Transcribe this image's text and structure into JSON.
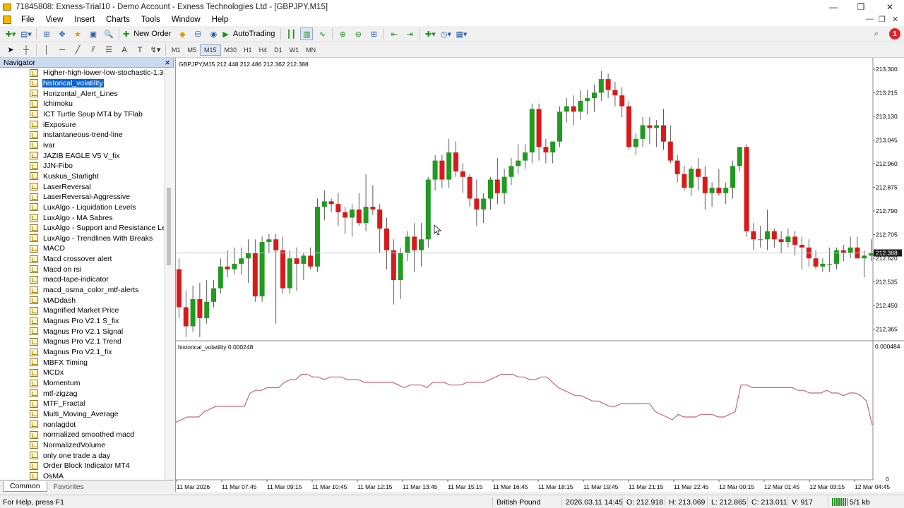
{
  "window": {
    "title": "71845808: Exness-Trial10 - Demo Account - Exness Technologies Ltd - [GBPJPY,M15]",
    "minimize": "—",
    "restore": "❐",
    "close": "✕"
  },
  "menu": [
    "File",
    "View",
    "Insert",
    "Charts",
    "Tools",
    "Window",
    "Help"
  ],
  "toolbar": {
    "new_order": "New Order",
    "autotrading": "AutoTrading",
    "alerts_badge": "1"
  },
  "timeframes": [
    "M1",
    "M5",
    "M15",
    "M30",
    "H1",
    "H4",
    "D1",
    "W1",
    "MN"
  ],
  "active_timeframe": "M15",
  "navigator": {
    "title": "Navigator",
    "close": "×",
    "items": [
      "Higher-high-lower-low-stochastic-1.3",
      "historical_volatility",
      "Horizontal_Alert_Lines",
      "Ichimoku",
      "ICT Turtle Soup MT4 by TFlab",
      "iExposure",
      "instantaneous-trend-line",
      "ivar",
      "JAZIB EAGLE V5 V_fix",
      "JJN-Fibo",
      "Kuskus_Starlight",
      "LaserReversal",
      "LaserReversal-Aggressive",
      "LuxAlgo - Liquidation Levels",
      "LuxAlgo - MA Sabres",
      "LuxAlgo - Support and Resistance Levels",
      "LuxAlgo - Trendlines With Breaks",
      "MACD",
      "Macd crossover alert",
      "Macd on rsi",
      "macd-tape-indicator",
      "macd_osma_color_mtf-alerts",
      "MADdash",
      "Magnified Market Price",
      "Magnus Pro V2.1 S_fix",
      "Magnus Pro V2.1 Signal",
      "Magnus Pro V2.1 Trend",
      "Magnus Pro V2.1_fix",
      "MBFX Timing",
      "MCDx",
      "Momentum",
      "mtf-zigzag",
      "MTF_Fractal",
      "Multi_Moving_Average",
      "nonlagdot",
      "normalized smoothed macd",
      "NormalizedVolume",
      "only one trade a day",
      "Order Block Indicator MT4",
      "OsMA"
    ],
    "selected": "historical_volatility",
    "tabs": [
      "Common",
      "Favorites"
    ]
  },
  "chart": {
    "header": "GBPJPY,M15  212.448 212.486 212.362 212.388",
    "indicator_label": "historical_volatility 0.000248",
    "price_labels": [
      "213.300",
      "213.215",
      "213.130",
      "213.045",
      "212.960",
      "212.875",
      "212.790",
      "212.705",
      "212.620",
      "212.535",
      "212.450",
      "212.365"
    ],
    "current_price": "212.388",
    "indicator_scale_top": "0.000484",
    "indicator_scale_bottom": "0",
    "time_labels": [
      "11 Mar 2026",
      "11 Mar 07:45",
      "11 Mar 09:15",
      "11 Mar 10:45",
      "11 Mar 12:15",
      "11 Mar 13:45",
      "11 Mar 15:15",
      "11 Mar 16:45",
      "11 Mar 18:15",
      "11 Mar 19:45",
      "11 Mar 21:15",
      "11 Mar 22:45",
      "12 Mar 00:15",
      "12 Mar 01:45",
      "12 Mar 03:15",
      "12 Mar 04:45"
    ],
    "colors": {
      "bull": "#1f9b1f",
      "bear": "#d91a1a",
      "indicator": "#c06a78"
    }
  },
  "chart_data": {
    "type": "candlestick",
    "symbol": "GBPJPY",
    "timeframe": "M15",
    "ylim": [
      212.34,
      213.34
    ],
    "candles": [
      [
        212.58,
        212.62,
        212.4,
        212.44
      ],
      [
        212.44,
        212.5,
        212.33,
        212.37
      ],
      [
        212.37,
        212.52,
        212.35,
        212.47
      ],
      [
        212.47,
        212.53,
        212.33,
        212.4
      ],
      [
        212.4,
        212.54,
        212.38,
        212.46
      ],
      [
        212.46,
        212.54,
        212.44,
        212.51
      ],
      [
        212.51,
        212.62,
        212.49,
        212.59
      ],
      [
        212.59,
        212.65,
        212.55,
        212.58
      ],
      [
        212.58,
        212.66,
        212.56,
        212.6
      ],
      [
        212.6,
        212.66,
        212.56,
        212.62
      ],
      [
        212.62,
        212.69,
        212.53,
        212.64
      ],
      [
        212.64,
        212.69,
        212.46,
        212.48
      ],
      [
        212.48,
        212.7,
        212.46,
        212.68
      ],
      [
        212.68,
        212.71,
        212.64,
        212.69
      ],
      [
        212.69,
        212.71,
        212.38,
        212.65
      ],
      [
        212.65,
        212.7,
        212.49,
        212.51
      ],
      [
        212.51,
        212.65,
        212.49,
        212.62
      ],
      [
        212.62,
        212.66,
        212.5,
        212.6
      ],
      [
        212.6,
        212.64,
        212.54,
        212.63
      ],
      [
        212.63,
        212.66,
        212.58,
        212.59
      ],
      [
        212.59,
        212.84,
        212.57,
        212.81
      ],
      [
        212.81,
        212.87,
        212.76,
        212.83
      ],
      [
        212.83,
        212.84,
        212.79,
        212.82
      ],
      [
        212.82,
        212.86,
        212.74,
        212.79
      ],
      [
        212.79,
        212.81,
        212.71,
        212.77
      ],
      [
        212.77,
        212.82,
        212.7,
        212.8
      ],
      [
        212.8,
        212.86,
        212.74,
        212.75
      ],
      [
        212.75,
        212.93,
        212.72,
        212.81
      ],
      [
        212.81,
        212.89,
        212.78,
        212.8
      ],
      [
        212.8,
        212.82,
        212.64,
        212.73
      ],
      [
        212.73,
        212.77,
        212.58,
        212.65
      ],
      [
        212.65,
        212.69,
        212.45,
        212.54
      ],
      [
        212.54,
        212.66,
        212.47,
        212.64
      ],
      [
        212.64,
        212.72,
        212.61,
        212.7
      ],
      [
        212.7,
        212.75,
        212.57,
        212.65
      ],
      [
        212.65,
        212.75,
        212.59,
        212.69
      ],
      [
        212.69,
        212.92,
        212.66,
        212.91
      ],
      [
        212.91,
        213.0,
        212.87,
        212.98
      ],
      [
        212.98,
        213.0,
        212.88,
        212.91
      ],
      [
        212.91,
        213.06,
        212.88,
        213.01
      ],
      [
        213.01,
        213.05,
        212.92,
        212.94
      ],
      [
        212.94,
        212.97,
        212.86,
        212.92
      ],
      [
        212.92,
        212.93,
        212.81,
        212.84
      ],
      [
        212.84,
        212.91,
        212.74,
        212.8
      ],
      [
        212.8,
        212.86,
        212.75,
        212.84
      ],
      [
        212.84,
        212.92,
        212.8,
        212.91
      ],
      [
        212.91,
        212.99,
        212.82,
        212.86
      ],
      [
        212.86,
        212.95,
        212.82,
        212.92
      ],
      [
        212.92,
        212.99,
        212.89,
        212.96
      ],
      [
        212.96,
        213.04,
        212.93,
        212.98
      ],
      [
        212.98,
        213.04,
        212.95,
        213.01
      ],
      [
        213.01,
        213.19,
        212.97,
        213.17
      ],
      [
        213.17,
        213.19,
        212.98,
        213.03
      ],
      [
        213.03,
        213.06,
        212.97,
        213.01
      ],
      [
        213.01,
        213.05,
        212.97,
        213.05
      ],
      [
        213.05,
        213.18,
        213.03,
        213.16
      ],
      [
        213.16,
        213.21,
        213.12,
        213.18
      ],
      [
        213.18,
        213.22,
        213.11,
        213.16
      ],
      [
        213.16,
        213.24,
        213.13,
        213.2
      ],
      [
        213.2,
        213.24,
        213.15,
        213.21
      ],
      [
        213.21,
        213.26,
        213.16,
        213.23
      ],
      [
        213.23,
        213.31,
        213.2,
        213.28
      ],
      [
        213.28,
        213.3,
        213.21,
        213.24
      ],
      [
        213.24,
        213.27,
        213.18,
        213.22
      ],
      [
        213.22,
        213.25,
        213.14,
        213.18
      ],
      [
        213.18,
        213.2,
        213.02,
        213.03
      ],
      [
        213.03,
        213.08,
        213.0,
        213.06
      ],
      [
        213.06,
        213.14,
        213.03,
        213.11
      ],
      [
        213.11,
        213.14,
        213.04,
        213.1
      ],
      [
        213.1,
        213.13,
        213.03,
        213.11
      ],
      [
        213.11,
        213.17,
        213.02,
        213.05
      ],
      [
        213.05,
        213.11,
        212.97,
        212.98
      ],
      [
        212.98,
        213.0,
        212.9,
        212.93
      ],
      [
        212.93,
        212.96,
        212.87,
        212.88
      ],
      [
        212.88,
        212.96,
        212.85,
        212.95
      ],
      [
        212.95,
        212.99,
        212.87,
        212.92
      ],
      [
        212.92,
        212.96,
        212.8,
        212.86
      ],
      [
        212.86,
        212.9,
        212.81,
        212.88
      ],
      [
        212.88,
        212.95,
        212.85,
        212.86
      ],
      [
        212.86,
        212.9,
        212.82,
        212.88
      ],
      [
        212.88,
        212.98,
        212.84,
        212.96
      ],
      [
        212.96,
        213.03,
        212.94,
        213.03
      ],
      [
        213.03,
        213.04,
        212.7,
        212.72
      ],
      [
        212.72,
        212.75,
        212.65,
        212.69
      ],
      [
        212.69,
        212.74,
        212.66,
        212.69
      ],
      [
        212.69,
        212.8,
        212.65,
        212.72
      ],
      [
        212.72,
        212.73,
        212.66,
        212.69
      ],
      [
        212.69,
        212.72,
        212.64,
        212.68
      ],
      [
        212.68,
        212.73,
        212.66,
        212.7
      ],
      [
        212.7,
        212.72,
        212.63,
        212.67
      ],
      [
        212.67,
        212.7,
        212.58,
        212.66
      ],
      [
        212.66,
        212.69,
        212.59,
        212.62
      ],
      [
        212.62,
        212.65,
        212.58,
        212.59
      ],
      [
        212.59,
        212.62,
        212.57,
        212.6
      ],
      [
        212.6,
        212.66,
        212.57,
        212.6
      ],
      [
        212.6,
        212.66,
        212.58,
        212.65
      ],
      [
        212.65,
        212.67,
        212.61,
        212.64
      ],
      [
        212.64,
        212.7,
        212.62,
        212.66
      ],
      [
        212.66,
        212.7,
        212.62,
        212.62
      ],
      [
        212.62,
        212.65,
        212.55,
        212.63
      ],
      [
        212.63,
        212.69,
        212.61,
        212.64
      ]
    ],
    "indicator": {
      "name": "historical_volatility",
      "ylim": [
        0,
        0.000484
      ],
      "values": [
        0.00021,
        0.00022,
        0.00023,
        0.00023,
        0.00023,
        0.00025,
        0.00026,
        0.00027,
        0.00027,
        0.00027,
        0.00027,
        0.00027,
        0.00027,
        0.00032,
        0.00033,
        0.00033,
        0.00034,
        0.00034,
        0.00034,
        0.00036,
        0.00037,
        0.00037,
        0.00039,
        0.00039,
        0.00038,
        0.00038,
        0.00037,
        0.00038,
        0.00038,
        0.00038,
        0.00037,
        0.00037,
        0.00037,
        0.00036,
        0.00036,
        0.00036,
        0.00036,
        0.00036,
        0.00036,
        0.00035,
        0.00034,
        0.00035,
        0.00035,
        0.00035,
        0.00034,
        0.00036,
        0.00036,
        0.00036,
        0.00035,
        0.00035,
        0.00035,
        0.00036,
        0.00036,
        0.00036,
        0.00036,
        0.00037,
        0.00038,
        0.00039,
        0.00039,
        0.00039,
        0.00038,
        0.00038,
        0.00037,
        0.00037,
        0.00038,
        0.00038,
        0.00036,
        0.00034,
        0.00033,
        0.00032,
        0.00031,
        0.00031,
        0.0003,
        0.00029,
        0.00029,
        0.00028,
        0.00027,
        0.00027,
        0.00028,
        0.00028,
        0.00028,
        0.00028,
        0.00028,
        0.00028,
        0.00025,
        0.00024,
        0.00023,
        0.00022,
        0.00024,
        0.00023,
        0.00023,
        0.00023,
        0.00024,
        0.00024,
        0.00024,
        0.00023,
        0.00023,
        0.00024,
        0.00025,
        0.00035,
        0.00035,
        0.00034,
        0.00034,
        0.00034,
        0.00034,
        0.00034,
        0.00034,
        0.00034,
        0.00034,
        0.00033,
        0.00033,
        0.00032,
        0.00032,
        0.00032,
        0.00033,
        0.00032,
        0.00032,
        0.00031,
        0.00032,
        0.00032,
        0.00031,
        0.00029,
        0.0002
      ]
    }
  },
  "status": {
    "help": "For Help, press F1",
    "profile": "British Pound",
    "time": "2026.03.11 14:45",
    "open": "O: 212.918",
    "high": "H: 213.069",
    "low": "L: 212.865",
    "close": "C: 213.011",
    "volume": "V: 917",
    "traffic": "5/1 kb"
  }
}
